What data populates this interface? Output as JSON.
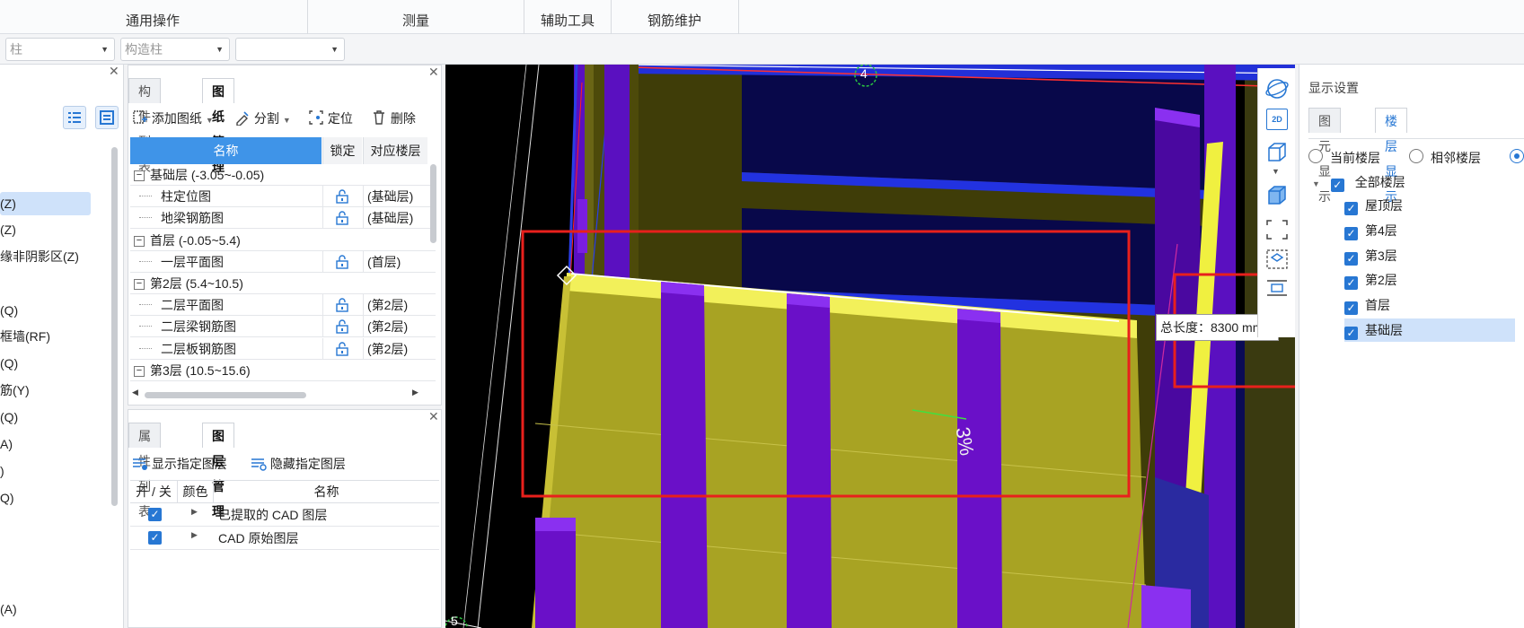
{
  "ribbon": {
    "groups": [
      "通用操作",
      "测量",
      "辅助工具",
      "钢筋维护"
    ]
  },
  "selectors": {
    "floor": "柱",
    "component": "构造柱",
    "sub": ""
  },
  "left_panel": {
    "items": [
      "(Z)",
      "(Z)",
      "缘非阴影区(Z)",
      "(Q)",
      "框墙(RF)",
      "(Q)",
      "筋(Y)",
      "(Q)",
      "A)",
      ")",
      "Q)",
      "(A)"
    ],
    "selected_index": 0
  },
  "drawing_panel": {
    "tabs": [
      "构件列表",
      "图纸管理"
    ],
    "active_tab": 1,
    "toolbar": {
      "add": "添加图纸",
      "split": "分割",
      "locate": "定位",
      "delete": "删除"
    },
    "columns": [
      "名称",
      "锁定",
      "对应楼层"
    ],
    "rows": [
      {
        "type": "group",
        "name": "基础层 (-3.05~-0.05)"
      },
      {
        "type": "item",
        "name": "柱定位图",
        "floor": "(基础层)"
      },
      {
        "type": "item",
        "name": "地梁钢筋图",
        "floor": "(基础层)"
      },
      {
        "type": "group",
        "name": "首层 (-0.05~5.4)"
      },
      {
        "type": "item",
        "name": "一层平面图",
        "floor": "(首层)"
      },
      {
        "type": "group",
        "name": "第2层 (5.4~10.5)"
      },
      {
        "type": "item",
        "name": "二层平面图",
        "floor": "(第2层)"
      },
      {
        "type": "item",
        "name": "二层梁钢筋图",
        "floor": "(第2层)"
      },
      {
        "type": "item",
        "name": "二层板钢筋图",
        "floor": "(第2层)"
      },
      {
        "type": "group",
        "name": "第3层 (10.5~15.6)"
      }
    ]
  },
  "layer_panel": {
    "tabs": [
      "属性列表",
      "图层管理"
    ],
    "active_tab": 1,
    "show_btn": "显示指定图层",
    "hide_btn": "隐藏指定图层",
    "columns": [
      "开 / 关",
      "颜色",
      "名称"
    ],
    "rows": [
      {
        "on": true,
        "name": "已提取的 CAD 图层"
      },
      {
        "on": true,
        "name": "CAD 原始图层"
      }
    ]
  },
  "viewport": {
    "axis_label_top": "4",
    "axis_label_bottom": "5",
    "slab_text": "3%",
    "tooltip": "总长度：8300 mm"
  },
  "side_tools": [
    "orbit-icon",
    "view-2d-icon",
    "view-3d-icon",
    "dropdown-icon",
    "box-icon",
    "fit-view-icon",
    "zoom-box-icon",
    "more-icon"
  ],
  "display_panel": {
    "title": "显示设置",
    "tabs": [
      "图元显示",
      "楼层显示"
    ],
    "active_tab": 1,
    "radios": [
      "当前楼层",
      "相邻楼层"
    ],
    "tree_root": "全部楼层",
    "floors": [
      "屋顶层",
      "第4层",
      "第3层",
      "第2层",
      "首层",
      "基础层"
    ],
    "selected_floor": "基础层"
  },
  "colors": {
    "accent": "#2777d3",
    "highlight_red": "#e8201c",
    "slab_yellow": "#a8a31f",
    "beam_purple": "#6a10c8"
  }
}
